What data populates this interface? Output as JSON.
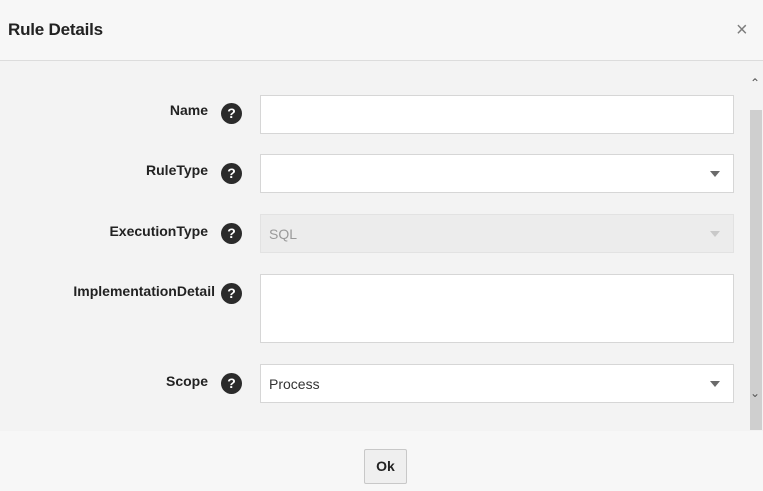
{
  "dialog": {
    "title": "Rule Details",
    "close_icon": "×"
  },
  "form": {
    "name": {
      "label": "Name",
      "value": ""
    },
    "rule_type": {
      "label": "RuleType",
      "value": ""
    },
    "execution_type": {
      "label": "ExecutionType",
      "value": "SQL"
    },
    "implementation_detail": {
      "label": "ImplementationDetail",
      "value": ""
    },
    "scope": {
      "label": "Scope",
      "value": "Process"
    }
  },
  "help_icon": "?",
  "footer": {
    "ok_label": "Ok"
  },
  "scrollbar": {
    "up_icon": "⌃",
    "down_icon": "⌄"
  }
}
